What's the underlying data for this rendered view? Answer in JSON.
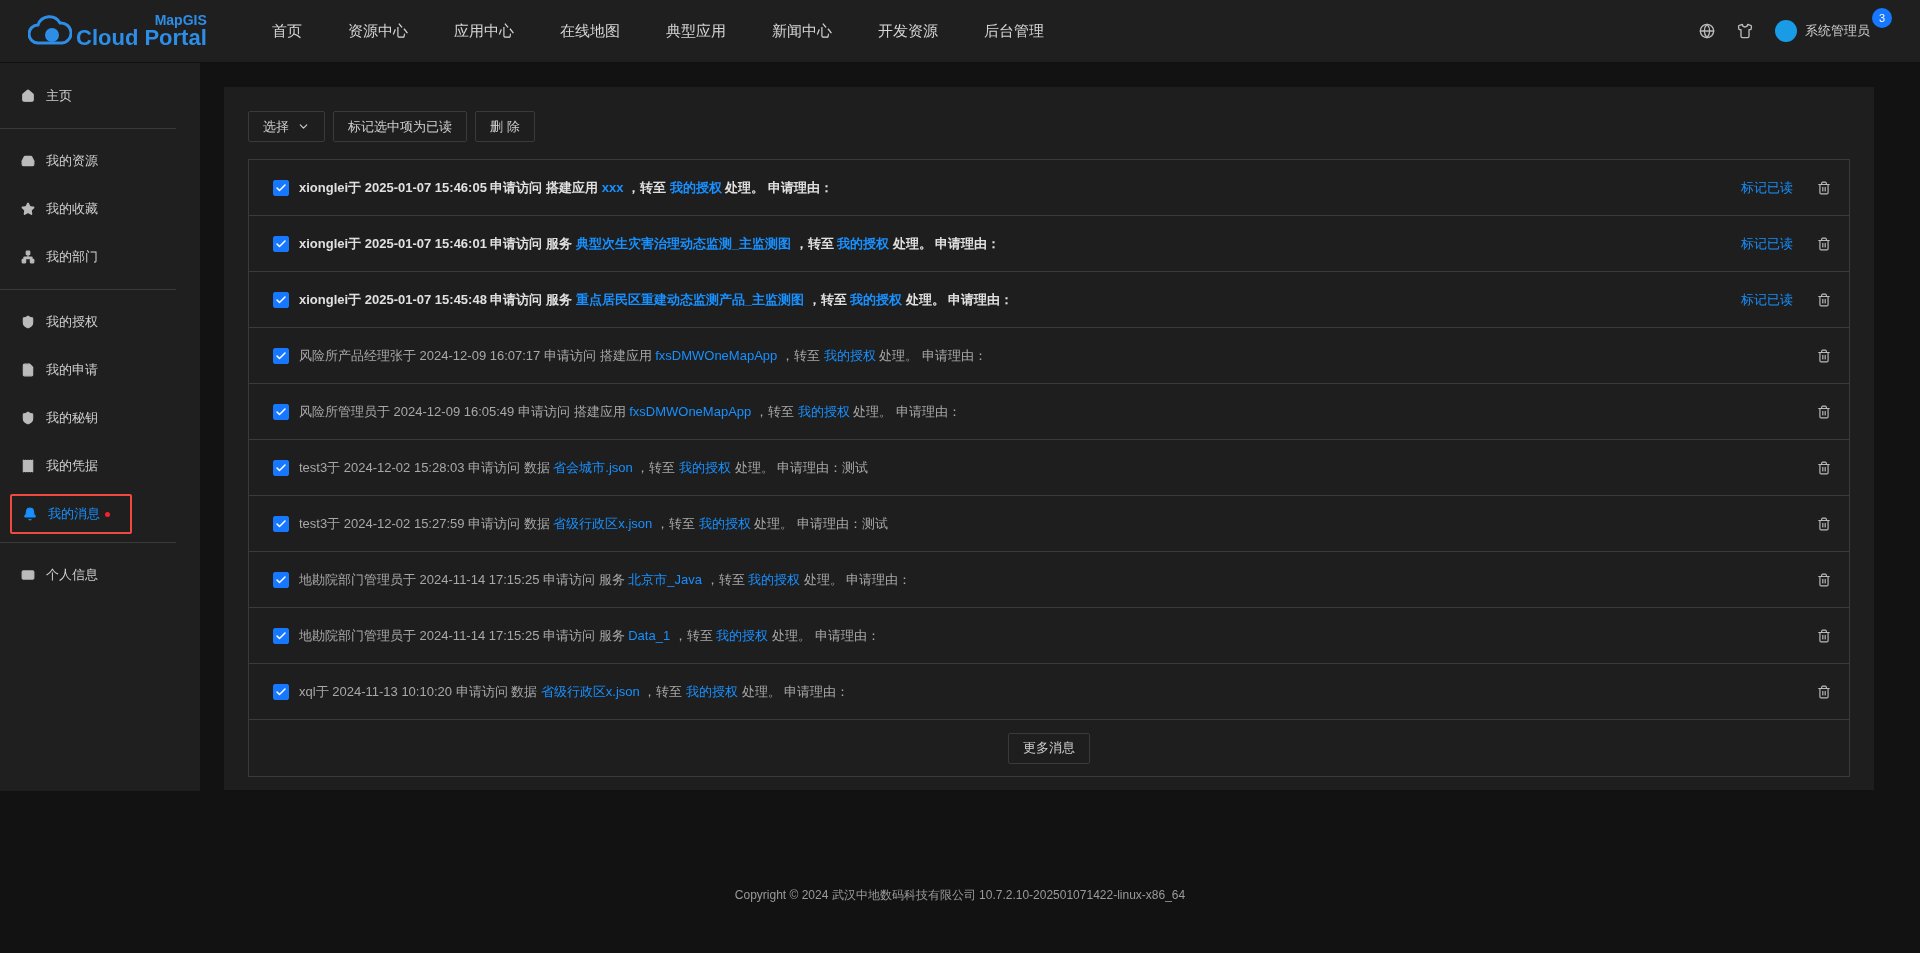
{
  "header": {
    "logo": {
      "top": "MapGIS",
      "bottom": "Cloud Portal"
    },
    "nav": [
      {
        "label": "首页",
        "selected": false
      },
      {
        "label": "资源中心",
        "selected": false
      },
      {
        "label": "应用中心",
        "selected": false
      },
      {
        "label": "在线地图",
        "selected": false
      },
      {
        "label": "典型应用",
        "selected": false
      },
      {
        "label": "新闻中心",
        "selected": false
      },
      {
        "label": "开发资源",
        "selected": false
      },
      {
        "label": "后台管理",
        "selected": false
      }
    ],
    "user": {
      "name": "系统管理员",
      "badge": "3"
    }
  },
  "sidebar": {
    "groups": [
      [
        {
          "label": "主页",
          "selected": false,
          "dot": false,
          "highlighted": false
        }
      ],
      [
        {
          "label": "我的资源",
          "selected": false,
          "dot": false,
          "highlighted": false
        },
        {
          "label": "我的收藏",
          "selected": false,
          "dot": false,
          "highlighted": false
        },
        {
          "label": "我的部门",
          "selected": false,
          "dot": false,
          "highlighted": false
        }
      ],
      [
        {
          "label": "我的授权",
          "selected": false,
          "dot": false,
          "highlighted": false
        },
        {
          "label": "我的申请",
          "selected": false,
          "dot": false,
          "highlighted": false
        },
        {
          "label": "我的秘钥",
          "selected": false,
          "dot": false,
          "highlighted": false
        },
        {
          "label": "我的凭据",
          "selected": false,
          "dot": false,
          "highlighted": false
        },
        {
          "label": "我的消息",
          "selected": true,
          "dot": true,
          "highlighted": true
        }
      ],
      [
        {
          "label": "个人信息",
          "selected": false,
          "dot": false,
          "highlighted": false
        }
      ]
    ]
  },
  "toolbar": {
    "select": "选择",
    "mark_selected": "标记选中项为已读",
    "delete": "删 除"
  },
  "messages": [
    {
      "checked": true,
      "unread": true,
      "before": "xionglei于 2025-01-07 15:46:05 申请访问 搭建应用 ",
      "resource": "xxx",
      "middle": " ，转至 ",
      "auth_link": "我的授权",
      "after": " 处理。 申请理由：",
      "mark_read": "标记已读"
    },
    {
      "checked": true,
      "unread": true,
      "before": "xionglei于 2025-01-07 15:46:01 申请访问 服务 ",
      "resource": "典型次生灾害治理动态监测_主监测图",
      "middle": " ，转至 ",
      "auth_link": "我的授权",
      "after": " 处理。 申请理由：",
      "mark_read": "标记已读"
    },
    {
      "checked": true,
      "unread": true,
      "before": "xionglei于 2025-01-07 15:45:48 申请访问 服务 ",
      "resource": "重点居民区重建动态监测产品_主监测图",
      "middle": " ，转至 ",
      "auth_link": "我的授权",
      "after": " 处理。 申请理由：",
      "mark_read": "标记已读"
    },
    {
      "checked": true,
      "unread": false,
      "before": "风险所产品经理张于 2024-12-09 16:07:17 申请访问 搭建应用 ",
      "resource": "fxsDMWOneMapApp",
      "middle": " ，转至 ",
      "auth_link": "我的授权",
      "after": " 处理。 申请理由："
    },
    {
      "checked": true,
      "unread": false,
      "before": "风险所管理员于 2024-12-09 16:05:49 申请访问 搭建应用 ",
      "resource": "fxsDMWOneMapApp",
      "middle": " ，转至 ",
      "auth_link": "我的授权",
      "after": " 处理。 申请理由："
    },
    {
      "checked": true,
      "unread": false,
      "before": "test3于 2024-12-02 15:28:03 申请访问 数据 ",
      "resource": "省会城市.json",
      "middle": " ，转至 ",
      "auth_link": "我的授权",
      "after": " 处理。 申请理由：测试"
    },
    {
      "checked": true,
      "unread": false,
      "before": "test3于 2024-12-02 15:27:59 申请访问 数据 ",
      "resource": "省级行政区x.json",
      "middle": " ，转至 ",
      "auth_link": "我的授权",
      "after": " 处理。 申请理由：测试"
    },
    {
      "checked": true,
      "unread": false,
      "before": "地勘院部门管理员于 2024-11-14 17:15:25 申请访问 服务 ",
      "resource": "北京市_Java",
      "middle": " ，转至 ",
      "auth_link": "我的授权",
      "after": " 处理。 申请理由："
    },
    {
      "checked": true,
      "unread": false,
      "before": "地勘院部门管理员于 2024-11-14 17:15:25 申请访问 服务 ",
      "resource": "Data_1",
      "middle": " ，转至 ",
      "auth_link": "我的授权",
      "after": " 处理。 申请理由："
    },
    {
      "checked": true,
      "unread": false,
      "before": "xql于 2024-11-13 10:10:20 申请访问 数据 ",
      "resource": "省级行政区x.json",
      "middle": " ，转至 ",
      "auth_link": "我的授权",
      "after": " 处理。 申请理由："
    }
  ],
  "more_button": "更多消息",
  "footer": "Copyright © 2024 武汉中地数码科技有限公司 10.7.2.10-202501071422-linux-x86_64"
}
